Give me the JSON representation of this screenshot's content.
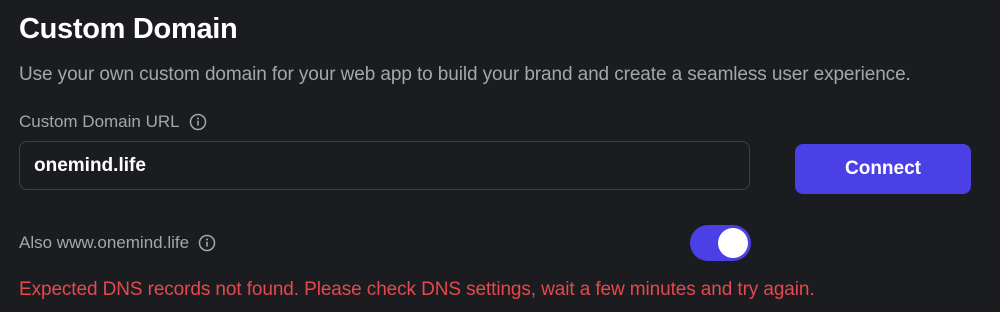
{
  "section": {
    "title": "Custom Domain",
    "description": "Use your own custom domain for your web app to build your brand and create a seamless user experience."
  },
  "domain_field": {
    "label": "Custom Domain URL",
    "value": "onemind.life",
    "label_icon": "info-icon"
  },
  "connect_button": {
    "label": "Connect"
  },
  "www_option": {
    "label": "Also www.onemind.life",
    "label_icon": "info-icon",
    "enabled": true
  },
  "error": {
    "message": "Expected DNS records not found. Please check DNS settings, wait a few minutes and try again."
  },
  "colors": {
    "background": "#1b1c1f",
    "accent": "#4a40e6",
    "error": "#e5484d",
    "muted_text": "#a4a6ab"
  }
}
